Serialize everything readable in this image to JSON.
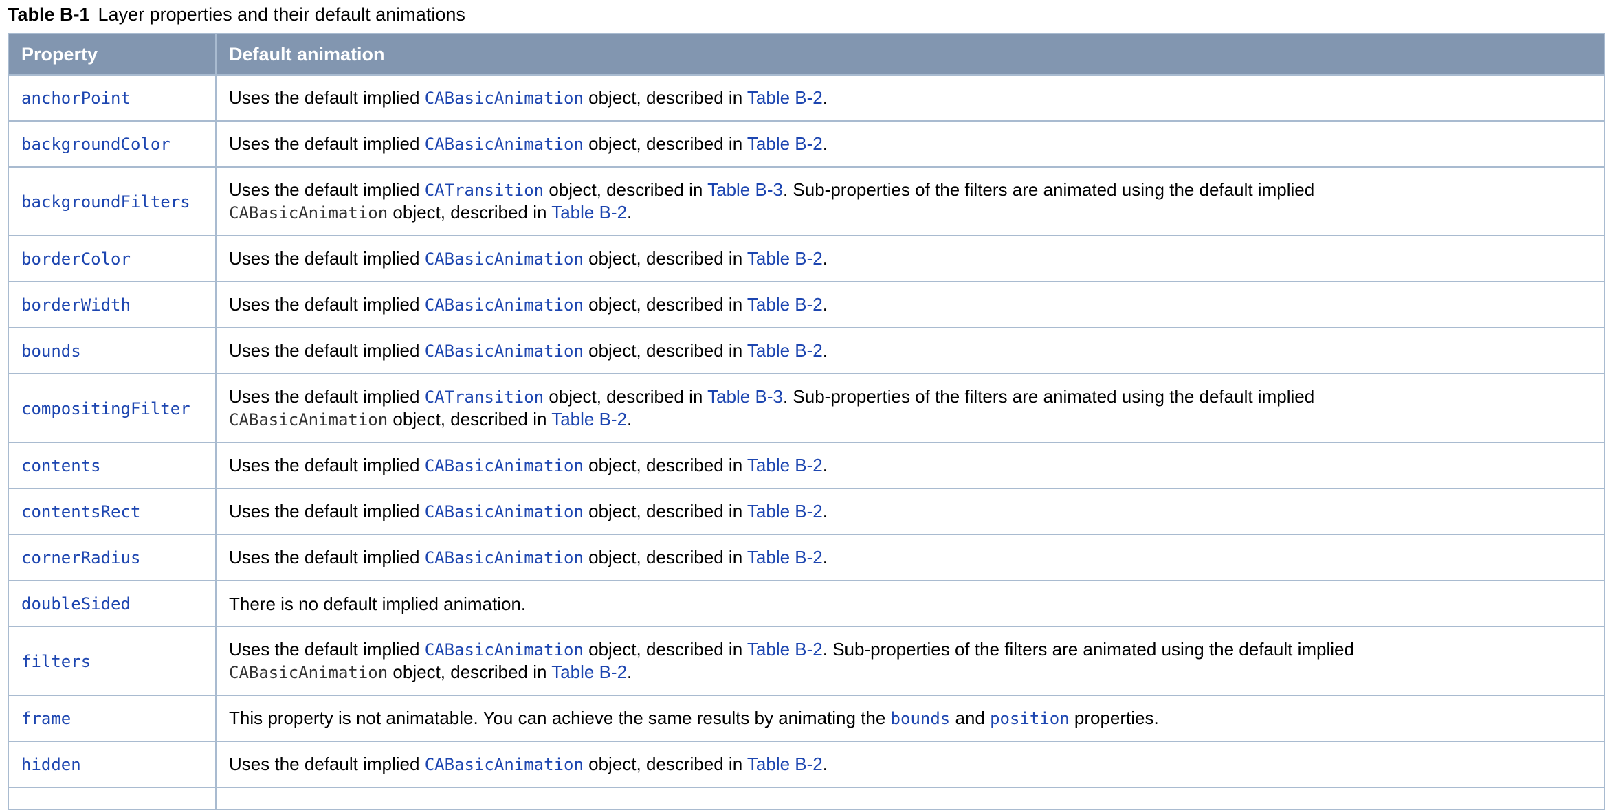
{
  "caption": {
    "number": "Table B-1",
    "title": "Layer properties and their default animations"
  },
  "table": {
    "headers": [
      "Property",
      "Default animation"
    ],
    "rows": [
      {
        "property": "anchorPoint",
        "segments": [
          {
            "t": "Uses the default implied "
          },
          {
            "t": "CABasicAnimation",
            "k": "code"
          },
          {
            "t": " object, described in "
          },
          {
            "t": "Table B-2",
            "k": "link"
          },
          {
            "t": "."
          }
        ]
      },
      {
        "property": "backgroundColor",
        "segments": [
          {
            "t": "Uses the default implied "
          },
          {
            "t": "CABasicAnimation",
            "k": "code"
          },
          {
            "t": " object, described in "
          },
          {
            "t": "Table B-2",
            "k": "link"
          },
          {
            "t": "."
          }
        ]
      },
      {
        "property": "backgroundFilters",
        "segments": [
          {
            "t": "Uses the default implied "
          },
          {
            "t": "CATransition",
            "k": "code"
          },
          {
            "t": " object, described in "
          },
          {
            "t": "Table B-3",
            "k": "link"
          },
          {
            "t": ". Sub-properties of the filters are animated using the default implied"
          },
          {
            "br": true
          },
          {
            "t": "CABasicAnimation",
            "k": "code-plain"
          },
          {
            "t": " object, described in "
          },
          {
            "t": "Table B-2",
            "k": "link"
          },
          {
            "t": "."
          }
        ]
      },
      {
        "property": "borderColor",
        "segments": [
          {
            "t": "Uses the default implied "
          },
          {
            "t": "CABasicAnimation",
            "k": "code"
          },
          {
            "t": " object, described in "
          },
          {
            "t": "Table B-2",
            "k": "link"
          },
          {
            "t": "."
          }
        ]
      },
      {
        "property": "borderWidth",
        "segments": [
          {
            "t": "Uses the default implied "
          },
          {
            "t": "CABasicAnimation",
            "k": "code"
          },
          {
            "t": " object, described in "
          },
          {
            "t": "Table B-2",
            "k": "link"
          },
          {
            "t": "."
          }
        ]
      },
      {
        "property": "bounds",
        "segments": [
          {
            "t": "Uses the default implied "
          },
          {
            "t": "CABasicAnimation",
            "k": "code"
          },
          {
            "t": " object, described in "
          },
          {
            "t": "Table B-2",
            "k": "link"
          },
          {
            "t": "."
          }
        ]
      },
      {
        "property": "compositingFilter",
        "segments": [
          {
            "t": "Uses the default implied "
          },
          {
            "t": "CATransition",
            "k": "code"
          },
          {
            "t": " object, described in "
          },
          {
            "t": "Table B-3",
            "k": "link"
          },
          {
            "t": ". Sub-properties of the filters are animated using the default implied"
          },
          {
            "br": true
          },
          {
            "t": "CABasicAnimation",
            "k": "code-plain"
          },
          {
            "t": " object, described in "
          },
          {
            "t": "Table B-2",
            "k": "link"
          },
          {
            "t": "."
          }
        ]
      },
      {
        "property": "contents",
        "segments": [
          {
            "t": "Uses the default implied "
          },
          {
            "t": "CABasicAnimation",
            "k": "code"
          },
          {
            "t": " object, described in "
          },
          {
            "t": "Table B-2",
            "k": "link"
          },
          {
            "t": "."
          }
        ]
      },
      {
        "property": "contentsRect",
        "segments": [
          {
            "t": "Uses the default implied "
          },
          {
            "t": "CABasicAnimation",
            "k": "code"
          },
          {
            "t": " object, described in "
          },
          {
            "t": "Table B-2",
            "k": "link"
          },
          {
            "t": "."
          }
        ]
      },
      {
        "property": "cornerRadius",
        "segments": [
          {
            "t": "Uses the default implied "
          },
          {
            "t": "CABasicAnimation",
            "k": "code"
          },
          {
            "t": " object, described in "
          },
          {
            "t": "Table B-2",
            "k": "link"
          },
          {
            "t": "."
          }
        ]
      },
      {
        "property": "doubleSided",
        "segments": [
          {
            "t": "There is no default implied animation."
          }
        ]
      },
      {
        "property": "filters",
        "segments": [
          {
            "t": "Uses the default implied "
          },
          {
            "t": "CABasicAnimation",
            "k": "code"
          },
          {
            "t": " object, described in "
          },
          {
            "t": "Table B-2",
            "k": "link"
          },
          {
            "t": ". Sub-properties of the filters are animated using the default implied"
          },
          {
            "br": true
          },
          {
            "t": "CABasicAnimation",
            "k": "code-plain"
          },
          {
            "t": " object, described in "
          },
          {
            "t": "Table B-2",
            "k": "link"
          },
          {
            "t": "."
          }
        ]
      },
      {
        "property": "frame",
        "segments": [
          {
            "t": "This property is not animatable. You can achieve the same results by animating the "
          },
          {
            "t": "bounds",
            "k": "code"
          },
          {
            "t": " and "
          },
          {
            "t": "position",
            "k": "code"
          },
          {
            "t": " properties."
          }
        ]
      },
      {
        "property": "hidden",
        "segments": [
          {
            "t": "Uses the default implied "
          },
          {
            "t": "CABasicAnimation",
            "k": "code"
          },
          {
            "t": " object, described in "
          },
          {
            "t": "Table B-2",
            "k": "link"
          },
          {
            "t": "."
          }
        ]
      }
    ]
  },
  "colors": {
    "header_bg": "#8296b0",
    "border": "#a9bbd0",
    "link": "#1c45b0"
  }
}
